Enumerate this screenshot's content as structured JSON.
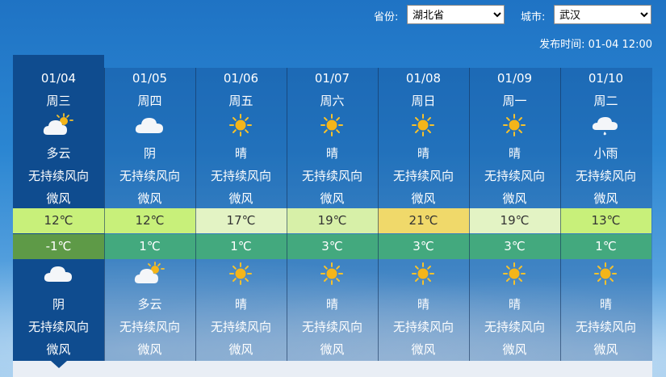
{
  "header": {
    "province_label": "省份:",
    "province_value": "湖北省",
    "city_label": "城市:",
    "city_value": "武汉",
    "publish_label": "发布时间:",
    "publish_time": "01-04 12:00"
  },
  "colors": {
    "today_bg": "#0f4c8f",
    "low_temp_bg": "#43a97e",
    "low_temp_today_bg": "#5e9a47",
    "high_temp_12": "#c8f07a",
    "high_temp_17": "#e3f3c4",
    "high_temp_19": "#d7f0a8",
    "high_temp_21": "#f0d96a",
    "high_temp_13": "#c8f07a"
  },
  "days": [
    {
      "date": "01/04",
      "week": "周三",
      "day_icon": "partly-cloudy-icon",
      "day_cond": "多云",
      "day_wind": "无持续风向",
      "day_wind_level": "微风",
      "high": "12℃",
      "high_color": "#c8f07a",
      "low": "-1℃",
      "low_color": "#5e9a47",
      "night_icon": "cloud-icon",
      "night_cond": "阴",
      "night_wind": "无持续风向",
      "night_wind_level": "微风"
    },
    {
      "date": "01/05",
      "week": "周四",
      "day_icon": "cloud-icon",
      "day_cond": "阴",
      "day_wind": "无持续风向",
      "day_wind_level": "微风",
      "high": "12℃",
      "high_color": "#c8f07a",
      "low": "1℃",
      "low_color": "#43a97e",
      "night_icon": "partly-cloudy-icon",
      "night_cond": "多云",
      "night_wind": "无持续风向",
      "night_wind_level": "微风"
    },
    {
      "date": "01/06",
      "week": "周五",
      "day_icon": "sun-icon",
      "day_cond": "晴",
      "day_wind": "无持续风向",
      "day_wind_level": "微风",
      "high": "17℃",
      "high_color": "#e3f3c4",
      "low": "1℃",
      "low_color": "#43a97e",
      "night_icon": "sun-icon",
      "night_cond": "晴",
      "night_wind": "无持续风向",
      "night_wind_level": "微风"
    },
    {
      "date": "01/07",
      "week": "周六",
      "day_icon": "sun-icon",
      "day_cond": "晴",
      "day_wind": "无持续风向",
      "day_wind_level": "微风",
      "high": "19℃",
      "high_color": "#d7f0a8",
      "low": "3℃",
      "low_color": "#43a97e",
      "night_icon": "sun-icon",
      "night_cond": "晴",
      "night_wind": "无持续风向",
      "night_wind_level": "微风"
    },
    {
      "date": "01/08",
      "week": "周日",
      "day_icon": "sun-icon",
      "day_cond": "晴",
      "day_wind": "无持续风向",
      "day_wind_level": "微风",
      "high": "21℃",
      "high_color": "#f0d96a",
      "low": "3℃",
      "low_color": "#43a97e",
      "night_icon": "sun-icon",
      "night_cond": "晴",
      "night_wind": "无持续风向",
      "night_wind_level": "微风"
    },
    {
      "date": "01/09",
      "week": "周一",
      "day_icon": "sun-icon",
      "day_cond": "晴",
      "day_wind": "无持续风向",
      "day_wind_level": "微风",
      "high": "19℃",
      "high_color": "#e3f3c4",
      "low": "3℃",
      "low_color": "#43a97e",
      "night_icon": "sun-icon",
      "night_cond": "晴",
      "night_wind": "无持续风向",
      "night_wind_level": "微风"
    },
    {
      "date": "01/10",
      "week": "周二",
      "day_icon": "rain-icon",
      "day_cond": "小雨",
      "day_wind": "无持续风向",
      "day_wind_level": "微风",
      "high": "13℃",
      "high_color": "#c8f07a",
      "low": "1℃",
      "low_color": "#43a97e",
      "night_icon": "sun-icon",
      "night_cond": "晴",
      "night_wind": "无持续风向",
      "night_wind_level": "微风"
    }
  ]
}
